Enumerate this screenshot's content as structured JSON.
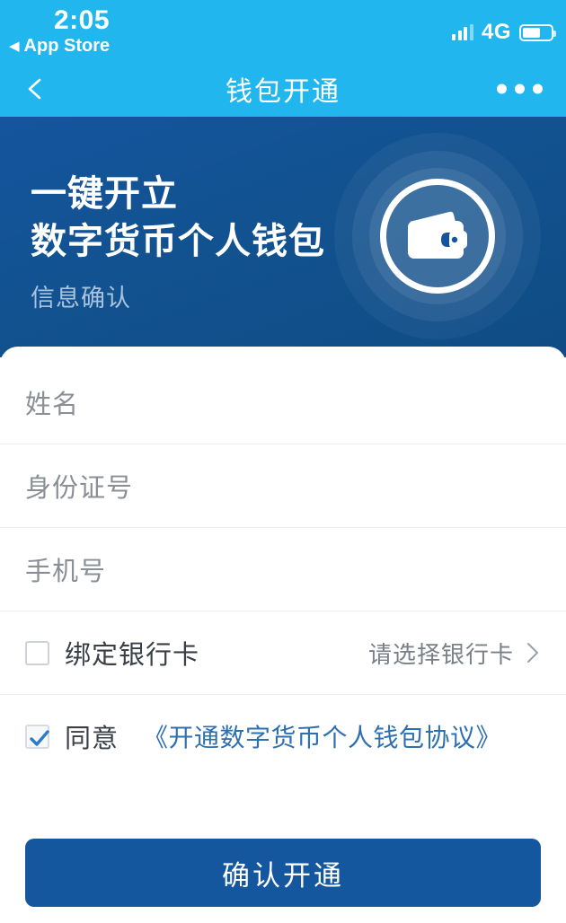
{
  "statusbar": {
    "time": "2:05",
    "back_label": "App Store",
    "back_arrow": "◀",
    "network": "4G",
    "signal_icon": "signal-bars-icon",
    "battery_icon": "battery-icon"
  },
  "navbar": {
    "title": "钱包开通",
    "back_icon": "chevron-left-icon",
    "more_icon": "more-dots-icon",
    "background": "#22B6EE"
  },
  "hero": {
    "line1": "一键开立",
    "line2": "数字货币个人钱包",
    "subtitle": "信息确认",
    "illustration_icon": "wallet-icon",
    "background": "#14559E",
    "subtitle_color": "#A9C3DE"
  },
  "form": {
    "fields": [
      {
        "name": "full-name",
        "placeholder": "姓名",
        "value": ""
      },
      {
        "name": "id-number",
        "placeholder": "身份证号",
        "value": ""
      },
      {
        "name": "phone-number",
        "placeholder": "手机号",
        "value": ""
      }
    ],
    "bank_row": {
      "checkbox_checked": false,
      "label": "绑定银行卡",
      "hint": "请选择银行卡",
      "chevron_icon": "chevron-right-icon"
    },
    "agreement_row": {
      "checkbox_checked": true,
      "check_icon": "check-icon",
      "label": "同意",
      "link_text": "《开通数字货币个人钱包协议》",
      "link_color": "#2E6FB0"
    }
  },
  "submit": {
    "label": "确认开通",
    "color": "#14579E"
  }
}
